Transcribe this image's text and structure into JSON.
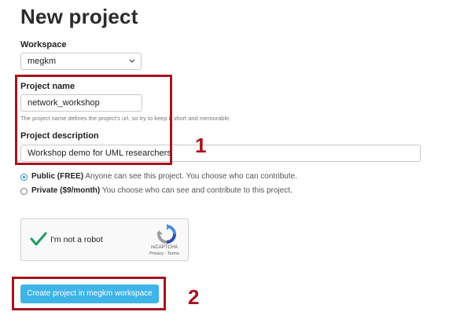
{
  "page": {
    "title": "New project"
  },
  "workspace": {
    "label": "Workspace",
    "value": "megkm"
  },
  "project_name": {
    "label": "Project name",
    "value": "network_workshop",
    "help": "The project name defines the project's url, so try to keep it short and memorable."
  },
  "project_description": {
    "label": "Project description",
    "value": "Workshop demo for UML researchers"
  },
  "visibility": {
    "public": {
      "title": "Public (FREE)",
      "desc": "Anyone can see this project. You choose who can contribute.",
      "selected": true
    },
    "private": {
      "title": "Private ($9/month)",
      "desc": "You choose who can see and contribute to this project.",
      "selected": false
    }
  },
  "recaptcha": {
    "label": "I'm not a robot",
    "brand": "reCAPTCHA",
    "links": "Privacy - Terms"
  },
  "create_button": {
    "label": "Create project in megkm workspace"
  },
  "annotations": {
    "marker_1": "1",
    "marker_2": "2",
    "color": "#a8121d"
  },
  "colors": {
    "button": "#3fb4e8",
    "radio_accent": "#2a8de0",
    "check_green": "#1a9e5f"
  }
}
